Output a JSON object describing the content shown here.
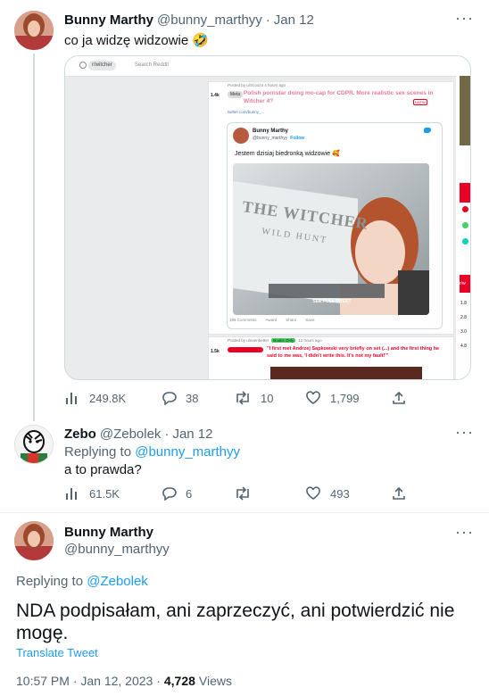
{
  "tweet1": {
    "name": "Bunny Marthy",
    "handle": "@bunny_marthyy",
    "sep": "·",
    "date": "Jan 12",
    "text": "co ja widzę widzowie 🤣",
    "stats": {
      "views": "249.8K",
      "replies": "38",
      "retweets": "10",
      "likes": "1,799"
    },
    "embed": {
      "search_pill": "r/witcher",
      "search_placeholder": "Search Reddit",
      "post1_meta": "Posted by u/Scooza 4 hours ago",
      "post1_votes": "1.4k",
      "post1_flair": "Meta",
      "post1_title": "Polish pornstar doing mo-cap for CDPR. More realistic sex scenes in Witcher 4?",
      "post1_nsfw": "NSFW",
      "post1_link": "twitter.com/bunny_...",
      "card_name": "Bunny Marthy",
      "card_handle": "@bunny_marthyy",
      "card_follow": "Follow",
      "card_text": "Jestem dzisiaj biedronką widzowie 🥰",
      "photo_text_big": "THE WITCHER",
      "photo_text_small": "WILD HUNT",
      "see_full": "SEE FULL TWEET",
      "post1_actions": [
        "196 Comments",
        "Award",
        "Share",
        "Save"
      ],
      "post2_votes": "1.5k",
      "post2_meta": "Posted by u/evenbetter",
      "post2_flair": "Books Only",
      "post2_time": "12 hours ago",
      "post2_quote": "\"I first met Andrzej Sapkowski very briefly on set (...) and the first thing he said to me was, 'I didn't write this. It's not my fault!'\"",
      "side_labels": [
        "1.8",
        "2.8",
        "3.0",
        "4.8"
      ],
      "side_tag": "r/w"
    }
  },
  "tweet2": {
    "name": "Zebo",
    "handle": "@Zebolek",
    "sep": "·",
    "date": "Jan 12",
    "replying_prefix": "Replying to",
    "replying_to": "@bunny_marthyy",
    "text": "a to prawda?",
    "stats": {
      "views": "61.5K",
      "replies": "6",
      "likes": "493"
    }
  },
  "tweet3": {
    "name": "Bunny Marthy",
    "handle": "@bunny_marthyy",
    "replying_prefix": "Replying to",
    "replying_to": "@Zebolek",
    "text": "NDA podpisałam, ani zaprzeczyć, ani potwierdzić nie mogę.",
    "translate": "Translate Tweet",
    "time": "10:57 PM · Jan 12, 2023 ·",
    "views_count": "4,728",
    "views_label": "Views"
  },
  "icons": [
    "more-icon",
    "views-icon",
    "reply-icon",
    "retweet-icon",
    "like-icon",
    "share-icon"
  ],
  "colors": {
    "link": "#1d9bf0",
    "muted": "#536471",
    "reddit_red": "#ea0027"
  }
}
